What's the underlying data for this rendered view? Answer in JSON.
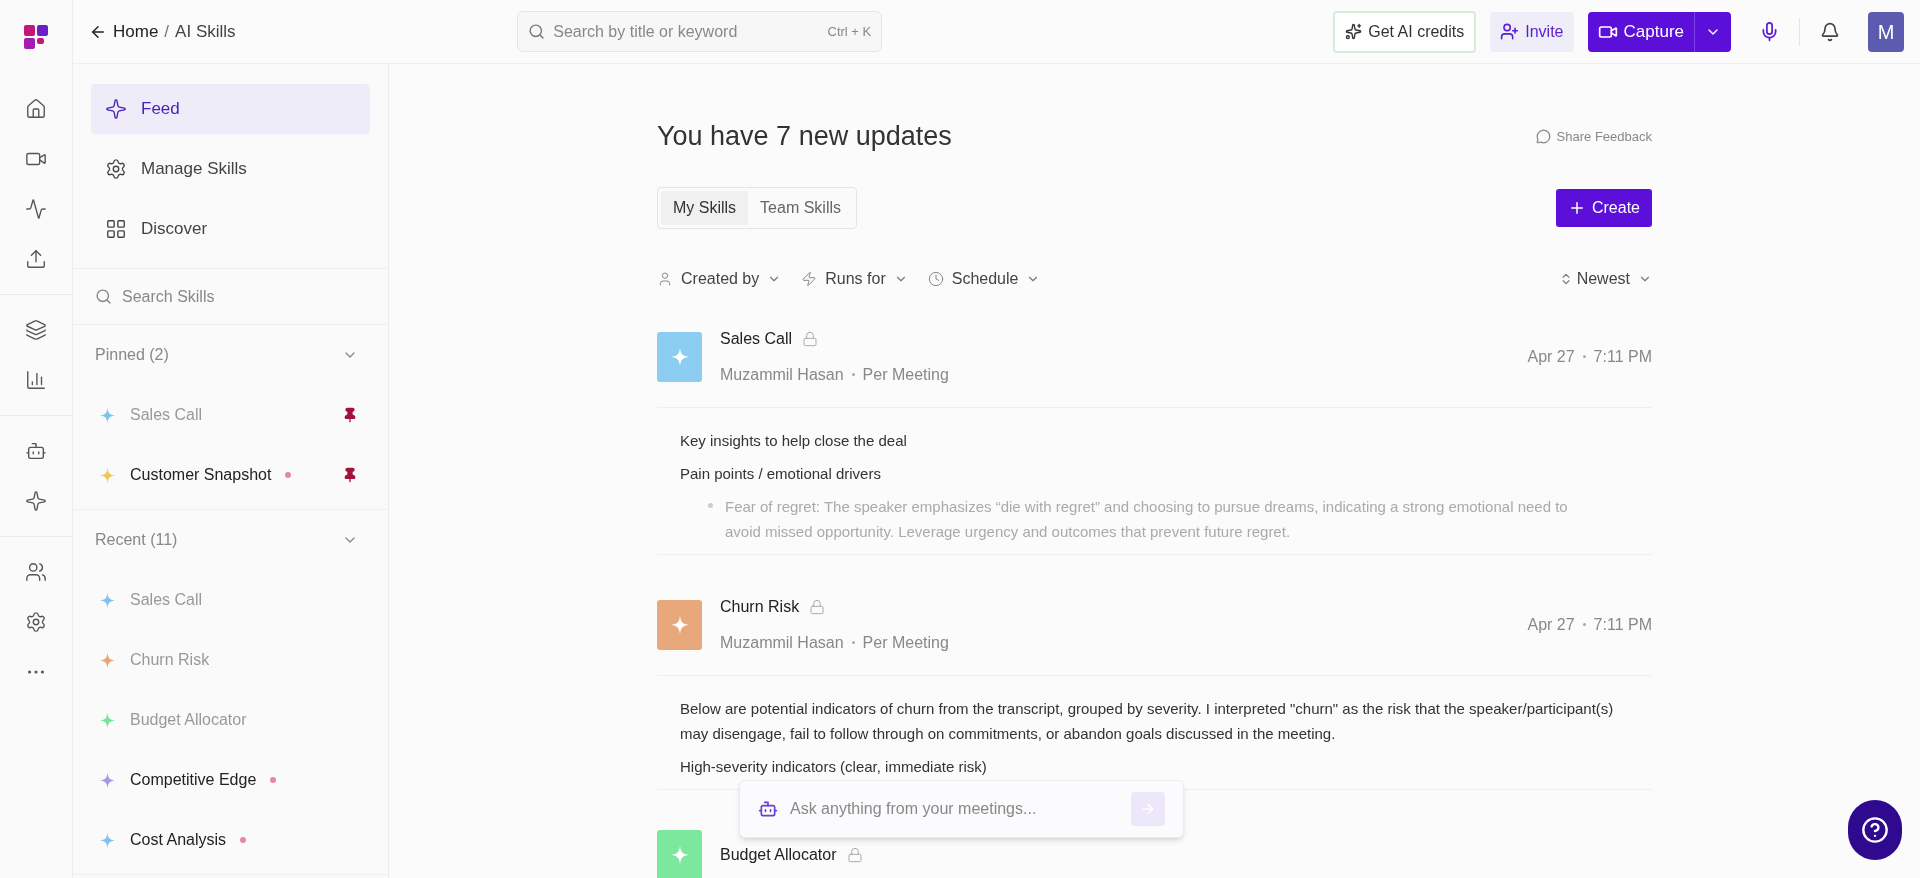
{
  "topbar": {
    "back_label": "Home",
    "separator": "/",
    "current": "AI Skills",
    "search": {
      "placeholder": "Search by title or keyword",
      "shortcut": "Ctrl + K"
    },
    "credits_button": "Get AI credits",
    "invite_button": "Invite",
    "capture_button": "Capture",
    "avatar": "M"
  },
  "rail": [
    {
      "kind": "home"
    },
    {
      "kind": "video"
    },
    {
      "kind": "activity"
    },
    {
      "kind": "upload"
    },
    {
      "kind": "divider"
    },
    {
      "kind": "layers"
    },
    {
      "kind": "chart"
    },
    {
      "kind": "divider"
    },
    {
      "kind": "bot"
    },
    {
      "kind": "sparkle"
    },
    {
      "kind": "divider"
    },
    {
      "kind": "users"
    },
    {
      "kind": "settings"
    },
    {
      "kind": "more"
    }
  ],
  "sidebar": {
    "nav": [
      {
        "kind": "sparkle",
        "label": "Feed",
        "selected": true
      },
      {
        "kind": "settings",
        "label": "Manage Skills",
        "selected": false
      },
      {
        "kind": "grid",
        "label": "Discover",
        "selected": false
      }
    ],
    "search": {
      "placeholder": "Search Skills"
    },
    "sections": [
      {
        "title": "Pinned (2)",
        "expanded": true,
        "items": [
          {
            "label": "Sales Call",
            "color": "#7cc4ef",
            "unread": false,
            "pinned": true
          },
          {
            "label": "Customer Snapshot",
            "color": "#ecc75a",
            "unread": true,
            "pinned": true
          }
        ]
      },
      {
        "title": "Recent (11)",
        "expanded": true,
        "items": [
          {
            "label": "Sales Call",
            "color": "#7cc4ef",
            "unread": false,
            "pinned": false
          },
          {
            "label": "Churn Risk",
            "color": "#e8a676",
            "unread": false,
            "pinned": false
          },
          {
            "label": "Budget Allocator",
            "color": "#6fe89a",
            "unread": false,
            "pinned": false
          },
          {
            "label": "Competitive Edge",
            "color": "#ab95e6",
            "unread": true,
            "pinned": false
          },
          {
            "label": "Cost Analysis",
            "color": "#7cc4ef",
            "unread": true,
            "pinned": false
          }
        ]
      }
    ]
  },
  "feed": {
    "title": "You have 7 new updates",
    "feedback": "Share Feedback",
    "tabs": [
      {
        "label": "My Skills",
        "selected": true
      },
      {
        "label": "Team Skills",
        "selected": false
      }
    ],
    "create_button": "Create",
    "filters": [
      {
        "kind": "user",
        "label": "Created by"
      },
      {
        "kind": "bolt",
        "label": "Runs for"
      },
      {
        "kind": "clock",
        "label": "Schedule"
      }
    ],
    "sort": "Newest",
    "cards": [
      {
        "title": "Sales Call",
        "color": "#8ccdf2",
        "locked": true,
        "author": "Muzammil Hasan",
        "frequency": "Per Meeting",
        "date": "Apr 27",
        "time": "7:11 PM",
        "body": [
          {
            "kind": "paragraph",
            "text": "Key insights to help close the deal"
          },
          {
            "kind": "paragraph",
            "text": "Pain points / emotional drivers"
          },
          {
            "kind": "bullet",
            "text": "Fear of regret: The speaker emphasizes “die with regret” and choosing to pursue dreams, indicating a strong emotional need to avoid missed opportunity. Leverage urgency and outcomes that prevent future regret."
          }
        ]
      },
      {
        "title": "Churn Risk",
        "color": "#e9a87b",
        "locked": true,
        "author": "Muzammil Hasan",
        "frequency": "Per Meeting",
        "date": "Apr 27",
        "time": "7:11 PM",
        "body": [
          {
            "kind": "paragraph",
            "text": "Below are potential indicators of churn from the transcript, grouped by severity. I interpreted \"churn\" as the risk that the speaker/participant(s) may disengage, fail to follow through on commitments, or abandon goals discussed in the meeting."
          },
          {
            "kind": "paragraph",
            "text": "High-severity indicators (clear, immediate risk)"
          }
        ]
      },
      {
        "title": "Budget Allocator",
        "color": "#7be89d",
        "locked": true
      }
    ]
  },
  "chat": {
    "placeholder": "Ask anything from your meetings..."
  }
}
